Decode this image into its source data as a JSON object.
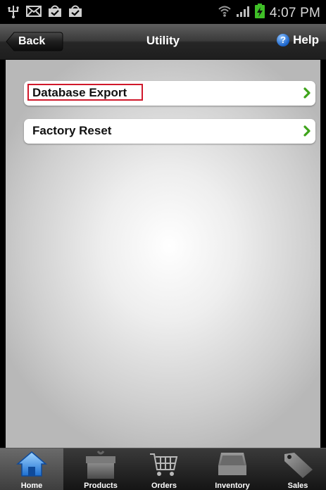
{
  "status_bar": {
    "time": "4:07 PM",
    "icons": [
      "usb-icon",
      "mail-icon",
      "bag-check-icon",
      "bag-check-icon",
      "wifi-icon",
      "signal-icon",
      "battery-charging-icon"
    ]
  },
  "header": {
    "back_label": "Back",
    "title": "Utility",
    "help_label": "Help"
  },
  "menu": {
    "items": [
      {
        "label": "Database Export"
      },
      {
        "label": "Factory Reset"
      }
    ]
  },
  "tab_bar": {
    "tabs": [
      {
        "label": "Home",
        "icon": "home-icon",
        "active": true
      },
      {
        "label": "Products",
        "icon": "box-icon",
        "active": false
      },
      {
        "label": "Orders",
        "icon": "cart-icon",
        "active": false
      },
      {
        "label": "Inventory",
        "icon": "tray-icon",
        "active": false
      },
      {
        "label": "Sales",
        "icon": "tag-icon",
        "active": false
      }
    ]
  },
  "colors": {
    "accent_chevron": "#3ea31a",
    "highlight": "#d0182b",
    "help_icon": "#1a63c9"
  }
}
